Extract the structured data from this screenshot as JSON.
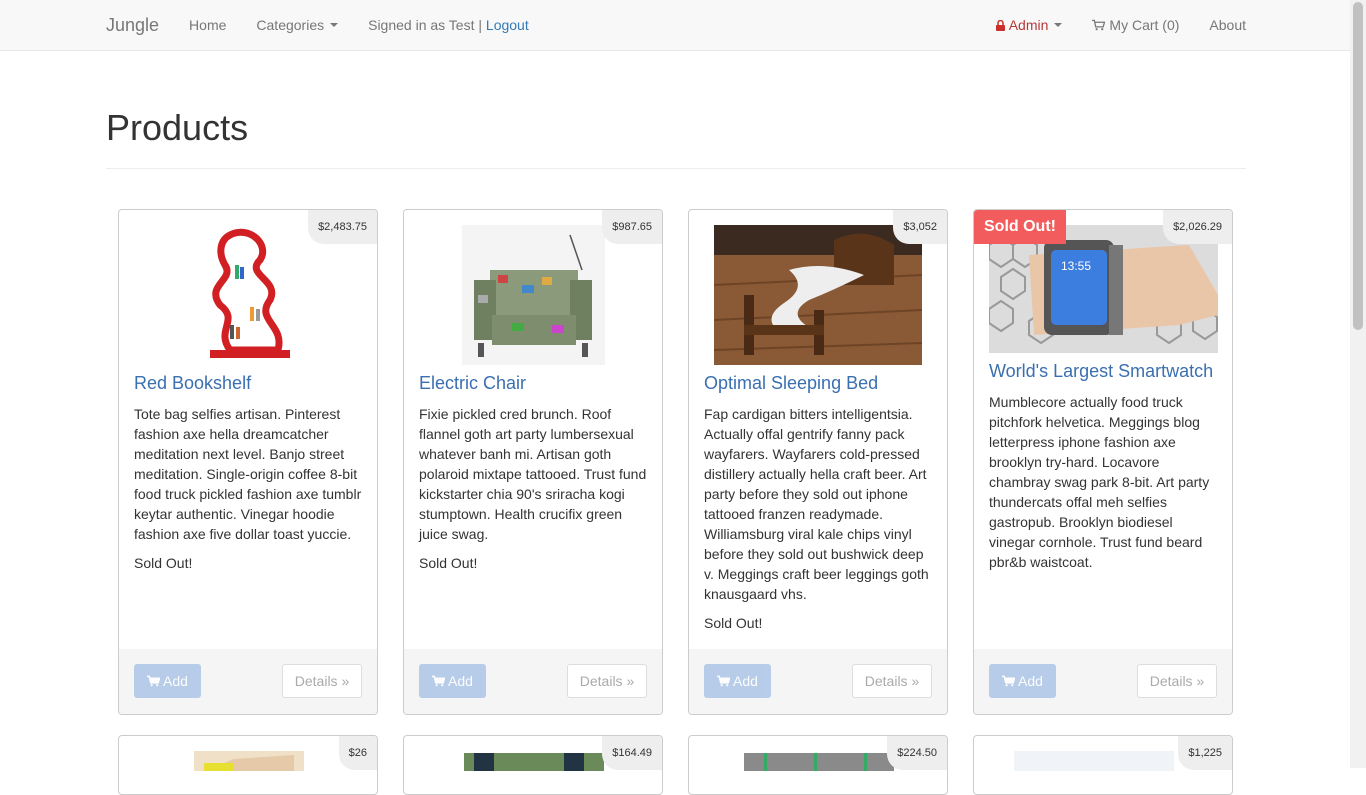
{
  "navbar": {
    "brand": "Jungle",
    "home": "Home",
    "categories": "Categories",
    "signed_in": "Signed in as Test | ",
    "logout": "Logout",
    "admin": "Admin",
    "cart": "My Cart (0)",
    "about": "About"
  },
  "page": {
    "title": "Products"
  },
  "products": [
    {
      "price": "$2,483.75",
      "name": "Red Bookshelf",
      "description": "Tote bag selfies artisan. Pinterest fashion axe hella dreamcatcher meditation next level. Banjo street meditation. Single-origin coffee 8-bit food truck pickled fashion axe tumblr keytar authentic. Vinegar hoodie fashion axe five dollar toast yuccie.",
      "status": "Sold Out!",
      "add_label": "Add",
      "details_label": "Details »"
    },
    {
      "price": "$987.65",
      "name": "Electric Chair",
      "description": "Fixie pickled cred brunch. Roof flannel goth art party lumbersexual whatever banh mi. Artisan goth polaroid mixtape tattooed. Trust fund kickstarter chia 90's sriracha kogi stumptown. Health crucifix green juice swag.",
      "status": "Sold Out!",
      "add_label": "Add",
      "details_label": "Details »"
    },
    {
      "price": "$3,052",
      "name": "Optimal Sleeping Bed",
      "description": "Fap cardigan bitters intelligentsia. Actually offal gentrify fanny pack wayfarers. Wayfarers cold-pressed distillery actually hella craft beer. Art party before they sold out iphone tattooed franzen readymade. Williamsburg viral kale chips vinyl before they sold out bushwick deep v. Meggings craft beer leggings goth knausgaard vhs.",
      "status": "Sold Out!",
      "add_label": "Add",
      "details_label": "Details »"
    },
    {
      "price": "$2,026.29",
      "badge": "Sold Out!",
      "name": "World's Largest Smartwatch",
      "description": "Mumblecore actually food truck pitchfork helvetica. Meggings blog letterpress iphone fashion axe brooklyn try-hard. Locavore chambray swag park 8-bit. Art party thundercats offal meh selfies gastropub. Brooklyn biodiesel vinegar cornhole. Trust fund beard pbr&b waistcoat.",
      "add_label": "Add",
      "details_label": "Details »"
    }
  ],
  "products_row2": [
    {
      "price": "$26"
    },
    {
      "price": "$164.49"
    },
    {
      "price": "$224.50"
    },
    {
      "price": "$1,225"
    }
  ],
  "colors": {
    "link": "#337ab7",
    "admin": "#b53a3a",
    "sold_badge": "#f25c5c",
    "add_button": "#a8c3e6"
  }
}
